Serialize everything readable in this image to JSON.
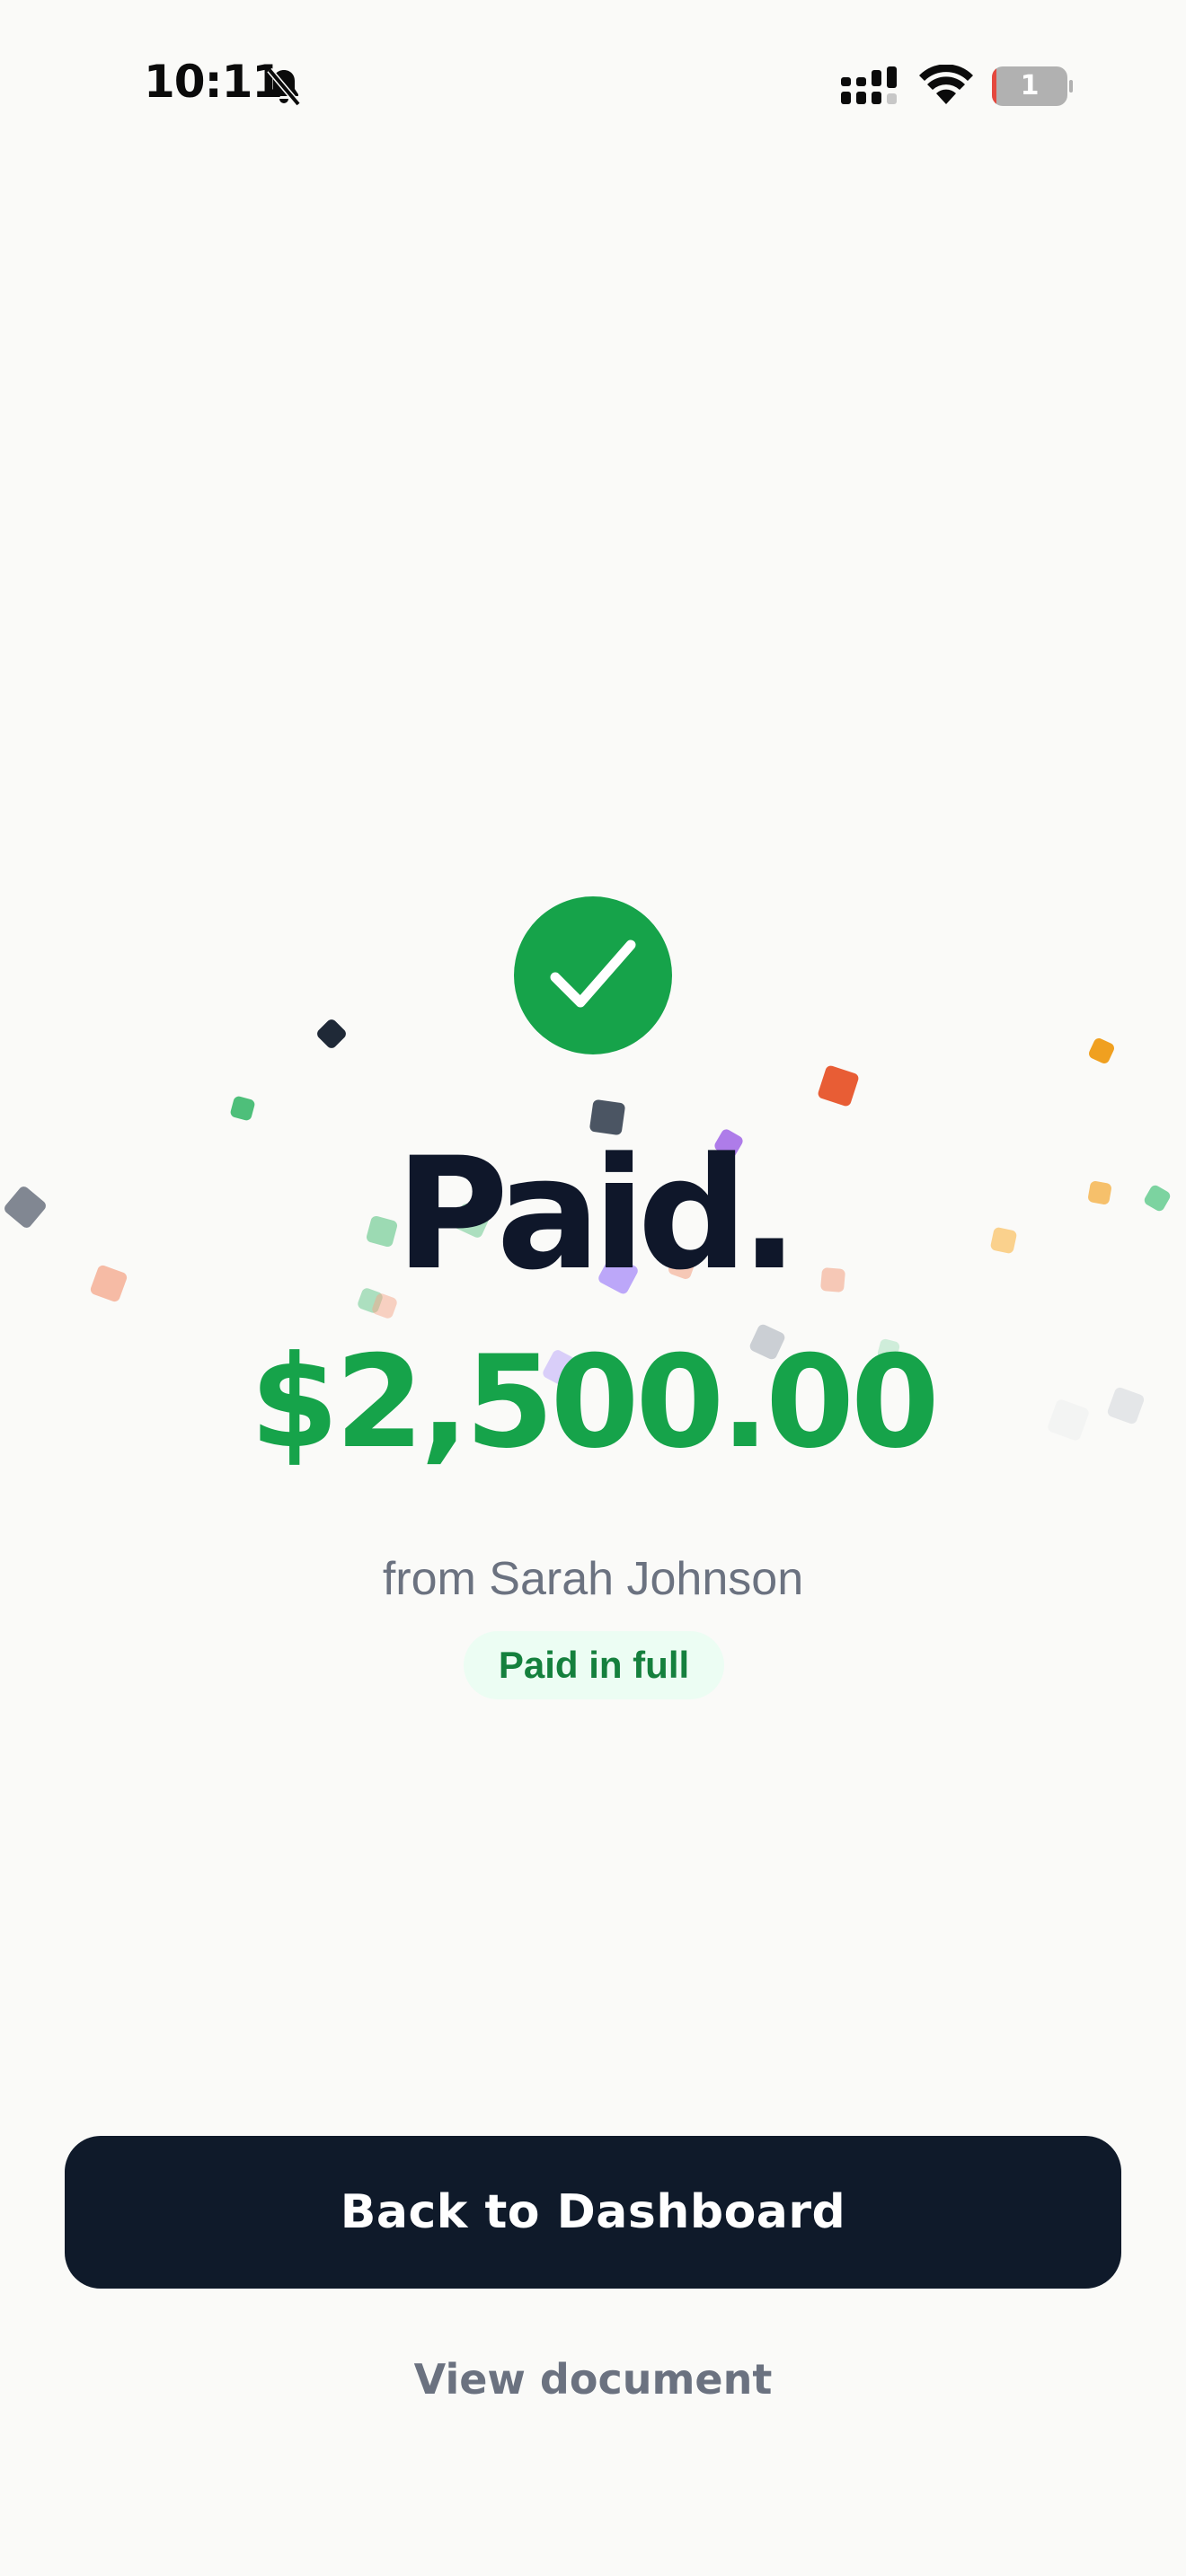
{
  "status_bar": {
    "time": "10:11",
    "battery_level": "1",
    "battery_fraction": 0.06,
    "icons": [
      "bell-slash-icon",
      "cellular-signal-icon",
      "wifi-icon",
      "battery-icon"
    ]
  },
  "success": {
    "icon": "checkmark-icon",
    "headline": "Paid.",
    "amount": "$2,500.00",
    "payer": "from Sarah Johnson",
    "badge": "Paid in full"
  },
  "actions": {
    "primary_label": "Back to Dashboard",
    "secondary_label": "View document"
  },
  "colors": {
    "success_green": "#16a34a",
    "headline_navy": "#0f172a",
    "button_dark": "#0f1a2a",
    "muted_text": "#6b7280",
    "badge_bg": "#ecfdf3",
    "badge_text": "#15803d",
    "background": "#fafaf8",
    "battery_low": "#e5483e"
  }
}
